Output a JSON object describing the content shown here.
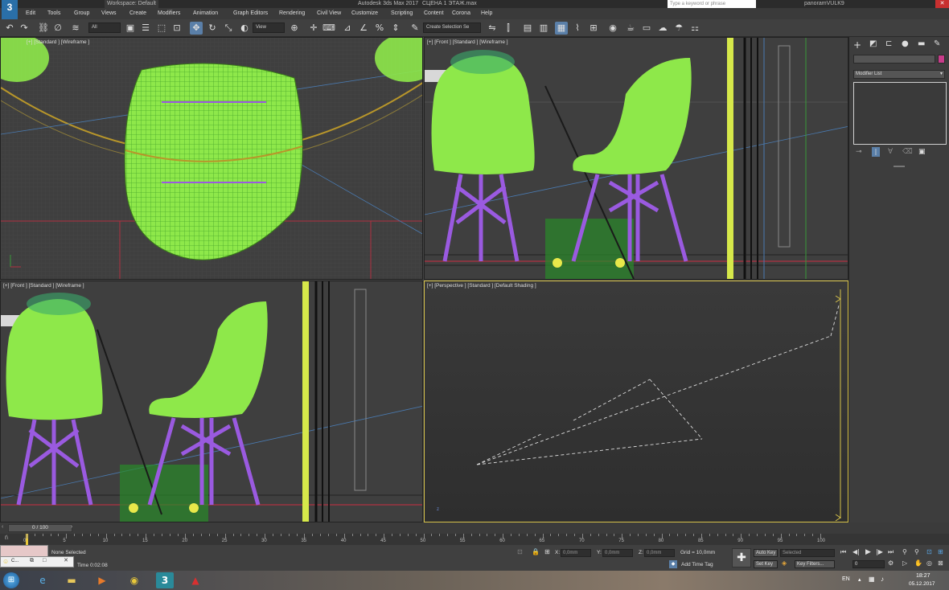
{
  "titlebar": {
    "app_icon": "3",
    "workspace": "Workspace: Default",
    "title": "Autodesk 3ds Max 2017",
    "file": "СЦЕНА 1 ЭТАЖ.max",
    "search_placeholder": "Type a keyword or phrase",
    "user": "panoramVULK9"
  },
  "menu": [
    "Edit",
    "Tools",
    "Group",
    "Views",
    "Create",
    "Modifiers",
    "Animation",
    "Graph Editors",
    "Rendering",
    "Civil View",
    "Customize",
    "Scripting",
    "Content",
    "Corona",
    "Help"
  ],
  "toolbar": {
    "filter": "All",
    "refcoord": "View",
    "selection_set": "Create Selection Se"
  },
  "viewports": {
    "top_left": "[+] [Standard ] [Wireframe ]",
    "top_right": "[+] [Front ] [Standard ] [Wireframe ]",
    "bottom_left": "[+] [Front ] [Standard ] [Wireframe ]",
    "bottom_right": "[+] [Perspective ] [Standard ] [Default Shading ]"
  },
  "command_panel": {
    "modifier_list": "Modifier List"
  },
  "timeline": {
    "frame": "0 / 100",
    "ticks": [
      "0",
      "5",
      "10",
      "15",
      "20",
      "25",
      "30",
      "35",
      "40",
      "45",
      "50",
      "55",
      "60",
      "65",
      "70",
      "75",
      "80",
      "85",
      "90",
      "95",
      "100"
    ]
  },
  "status": {
    "selection": "None Selected",
    "time": "Time  0:02:08",
    "x_label": "X:",
    "x_value": "0,0mm",
    "y_label": "Y:",
    "y_value": "0,0mm",
    "z_label": "Z:",
    "z_value": "0,0mm",
    "grid": "Grid = 10,0mm",
    "add_time_tag": "Add Time Tag",
    "auto_key": "Auto Key",
    "set_key": "Set Key",
    "key_mode": "Selected",
    "key_filters": "Key Filters...",
    "frame_field": "0"
  },
  "taskbar": {
    "mini_label": "C...",
    "lang": "EN",
    "time": "18:27",
    "date": "05.12.2017"
  },
  "colors": {
    "chair_green": "#8ee84a",
    "leg_purple": "#9a5ae0",
    "selection_yellow": "#d6c24a",
    "active_blue": "#5a7fa8"
  }
}
